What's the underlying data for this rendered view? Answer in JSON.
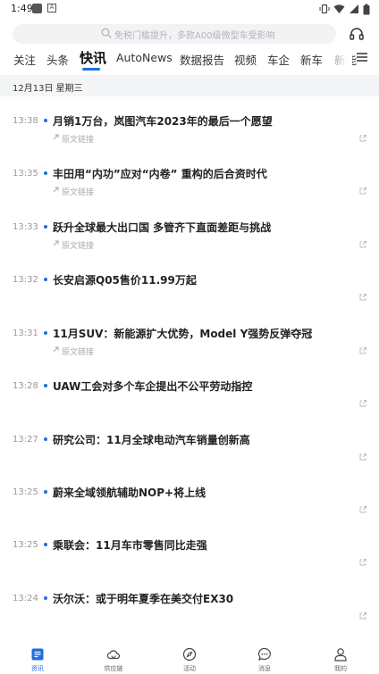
{
  "status_bar": {
    "time": "1:49"
  },
  "search": {
    "placeholder": "免税门槛提升，多款A00级微型车受影响"
  },
  "tabs": [
    "关注",
    "头条",
    "快讯",
    "AutoNews",
    "数据报告",
    "视频",
    "车企",
    "新车",
    "新能"
  ],
  "active_tab": "快讯",
  "date_header": "12月13日 星期三",
  "news": [
    {
      "time": "13:38",
      "title": "月销1万台，岚图汽车2023年的最后一个愿望",
      "link": "原文链接"
    },
    {
      "time": "13:35",
      "title": "丰田用“内功”应对“内卷” 重构的后合资时代",
      "link": "原文链接"
    },
    {
      "time": "13:33",
      "title": "跃升全球最大出口国 多管齐下直面差距与挑战",
      "link": "原文链接"
    },
    {
      "time": "13:32",
      "title": "长安启源Q05售价11.99万起",
      "link": ""
    },
    {
      "time": "13:31",
      "title": "11月SUV：新能源扩大优势，Model Y强势反弹夺冠",
      "link": "原文链接"
    },
    {
      "time": "13:28",
      "title": "UAW工会对多个车企提出不公平劳动指控",
      "link": ""
    },
    {
      "time": "13:27",
      "title": "研究公司：11月全球电动汽车销量创新高",
      "link": ""
    },
    {
      "time": "13:25",
      "title": "蔚来全域领航辅助NOP+将上线",
      "link": ""
    },
    {
      "time": "13:25",
      "title": "乘联会：11月车市零售同比走强",
      "link": ""
    },
    {
      "time": "13:24",
      "title": "沃尔沃：或于明年夏季在美交付EX30",
      "link": ""
    }
  ],
  "bottom_nav": [
    {
      "label": "资讯",
      "icon": "news-icon",
      "active": true
    },
    {
      "label": "供应链",
      "icon": "cloud-icon",
      "active": false
    },
    {
      "label": "活动",
      "icon": "compass-icon",
      "active": false
    },
    {
      "label": "消息",
      "icon": "message-icon",
      "active": false
    },
    {
      "label": "我的",
      "icon": "profile-icon",
      "active": false
    }
  ],
  "colors": {
    "accent": "#1a6fe6",
    "date_bar": "#f4f5f7",
    "search_bg": "#f2f3f5"
  }
}
